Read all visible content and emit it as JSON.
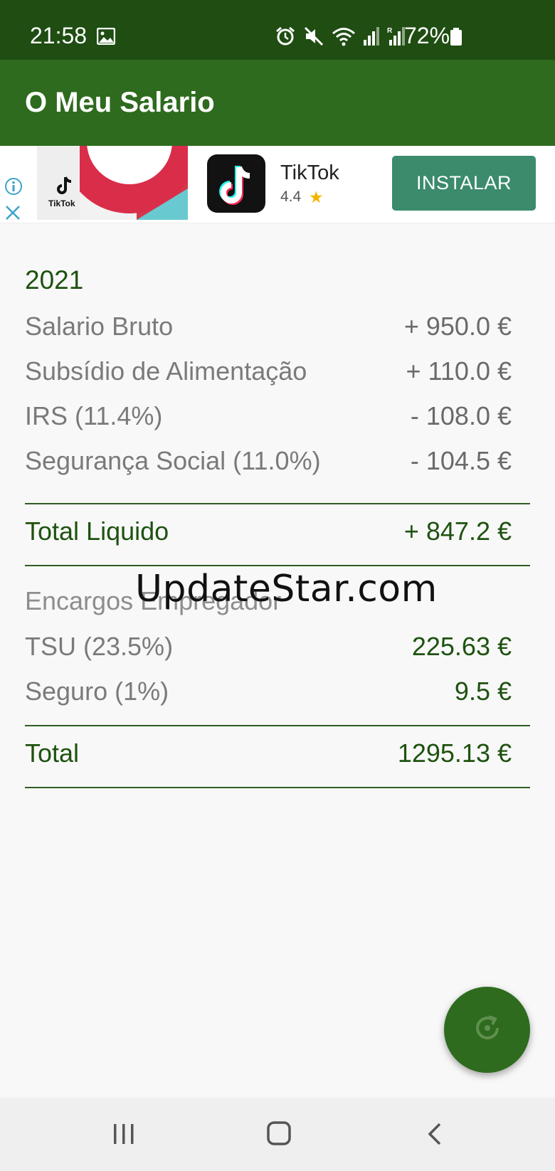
{
  "status_bar": {
    "time": "21:58",
    "battery": "72%",
    "icons": [
      "image-icon",
      "alarm-icon",
      "mute-icon",
      "wifi-icon",
      "signal-icon",
      "signal-roaming-icon",
      "battery-icon"
    ]
  },
  "app_bar": {
    "title": "O Meu Salario"
  },
  "ad": {
    "banner_brand": "TikTok",
    "app_name": "TikTok",
    "rating": "4.4",
    "install_label": "INSTALAR",
    "button_color": "#3b8b6c"
  },
  "summary": {
    "year": "2021",
    "rows": [
      {
        "label": "Salario Bruto",
        "value": "+ 950.0 €"
      },
      {
        "label": "Subsídio de Alimentação",
        "value": "+ 110.0 €"
      },
      {
        "label": "IRS (11.4%)",
        "value": "- 108.0 €"
      },
      {
        "label": "Segurança Social (11.0%)",
        "value": "- 104.5 €"
      }
    ],
    "total_liquido": {
      "label": "Total Liquido",
      "value": "+ 847.2 €"
    },
    "employer_section": "Encargos Empregador",
    "employer_rows": [
      {
        "label": "TSU (23.5%)",
        "value": "225.63 €"
      },
      {
        "label": "Seguro (1%)",
        "value": "9.5 €"
      }
    ],
    "total": {
      "label": "Total",
      "value": "1295.13 €"
    }
  },
  "watermark": "UpdateStar.com",
  "colors": {
    "status_bar": "#1f4d12",
    "app_bar": "#2e6b1e",
    "accent_text": "#1e5210"
  }
}
